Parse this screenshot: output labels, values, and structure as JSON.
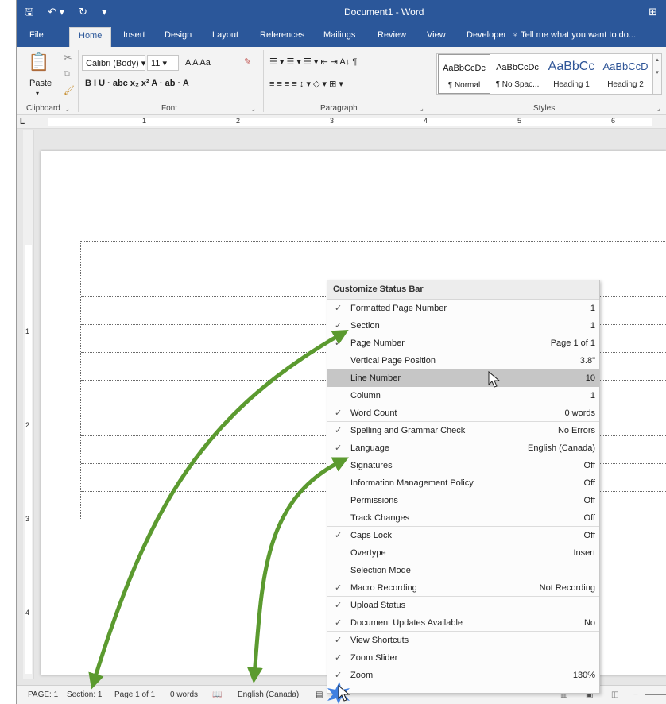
{
  "titlebar": {
    "save_icon": "save-icon",
    "undo_icon": "undo-icon",
    "redo_icon": "redo-icon",
    "customize_icon": "dropdown-icon",
    "title": "Document1 - Word",
    "ribbon_display_icon": "ribbon-display-options-icon"
  },
  "tabs": [
    "File",
    "Home",
    "Insert",
    "Design",
    "Layout",
    "References",
    "Mailings",
    "Review",
    "View",
    "Developer"
  ],
  "tell_me": "Tell me what you want to do...",
  "ribbon": {
    "clipboard": {
      "paste": "Paste",
      "label": "Clipboard"
    },
    "font": {
      "name": "Calibri (Body)",
      "size": "11",
      "label": "Font",
      "row1": "A  A   Aa",
      "row2": "B  I  U  ·  abc  x₂  x²   A  ·  ab  ·  A"
    },
    "paragraph": {
      "label": "Paragraph",
      "row1": "☰ ▾  ☰ ▾  ☰ ▾   ⇤  ⇥   A↓   ¶",
      "row2": "≡  ≡  ≡  ≡   ↕ ▾   ◇ ▾  ⊞ ▾"
    },
    "styles": {
      "label": "Styles",
      "items": [
        {
          "sample": "AaBbCcDc",
          "name": "¶ Normal"
        },
        {
          "sample": "AaBbCcDc",
          "name": "¶ No Spac..."
        },
        {
          "sample": "AaBbCc",
          "name": "Heading 1"
        },
        {
          "sample": "AaBbCcD",
          "name": "Heading 2"
        }
      ]
    }
  },
  "ruler": {
    "tab_selector": "L",
    "h_numbers": [
      "1",
      "2",
      "3",
      "4",
      "5",
      "6"
    ],
    "v_numbers": [
      "1",
      "2",
      "3",
      "4"
    ]
  },
  "table": {
    "rows": 10
  },
  "menu": {
    "title": "Customize Status Bar",
    "items": [
      {
        "checked": true,
        "label": "Formatted Page Number",
        "value": "1"
      },
      {
        "checked": true,
        "label": "Section",
        "value": "1"
      },
      {
        "checked": true,
        "label": "Page Number",
        "value": "Page 1 of 1"
      },
      {
        "checked": false,
        "label": "Vertical Page Position",
        "value": "3.8\""
      },
      {
        "checked": false,
        "label": "Line Number",
        "value": "10"
      },
      {
        "checked": false,
        "label": "Column",
        "value": "1"
      },
      {
        "checked": true,
        "label": "Word Count",
        "value": "0 words"
      },
      {
        "checked": true,
        "label": "Spelling and Grammar Check",
        "value": "No Errors"
      },
      {
        "checked": true,
        "label": "Language",
        "value": "English (Canada)"
      },
      {
        "checked": true,
        "label": "Signatures",
        "value": "Off"
      },
      {
        "checked": false,
        "label": "Information Management Policy",
        "value": "Off"
      },
      {
        "checked": false,
        "label": "Permissions",
        "value": "Off"
      },
      {
        "checked": false,
        "label": "Track Changes",
        "value": "Off"
      },
      {
        "checked": true,
        "label": "Caps Lock",
        "value": "Off"
      },
      {
        "checked": false,
        "label": "Overtype",
        "value": "Insert"
      },
      {
        "checked": false,
        "label": "Selection Mode",
        "value": ""
      },
      {
        "checked": true,
        "label": "Macro Recording",
        "value": "Not Recording"
      },
      {
        "checked": true,
        "label": "Upload Status",
        "value": ""
      },
      {
        "checked": true,
        "label": "Document Updates Available",
        "value": "No"
      },
      {
        "checked": true,
        "label": "View Shortcuts",
        "value": ""
      },
      {
        "checked": true,
        "label": "Zoom Slider",
        "value": ""
      },
      {
        "checked": true,
        "label": "Zoom",
        "value": "130%"
      }
    ]
  },
  "statusbar": {
    "page": "PAGE: 1",
    "section": "Section: 1",
    "page_of": "Page 1 of 1",
    "words": "0 words",
    "proofing_icon": "proofing-icon",
    "language": "English (Canada)",
    "macro_icon": "macro-recording-icon",
    "view_icons": [
      "read-mode-icon",
      "print-layout-icon",
      "web-layout-icon"
    ]
  },
  "colors": {
    "brand": "#2b579a",
    "annotation_arrow": "#5b9a2f",
    "highlight": "#c6c6c6"
  }
}
